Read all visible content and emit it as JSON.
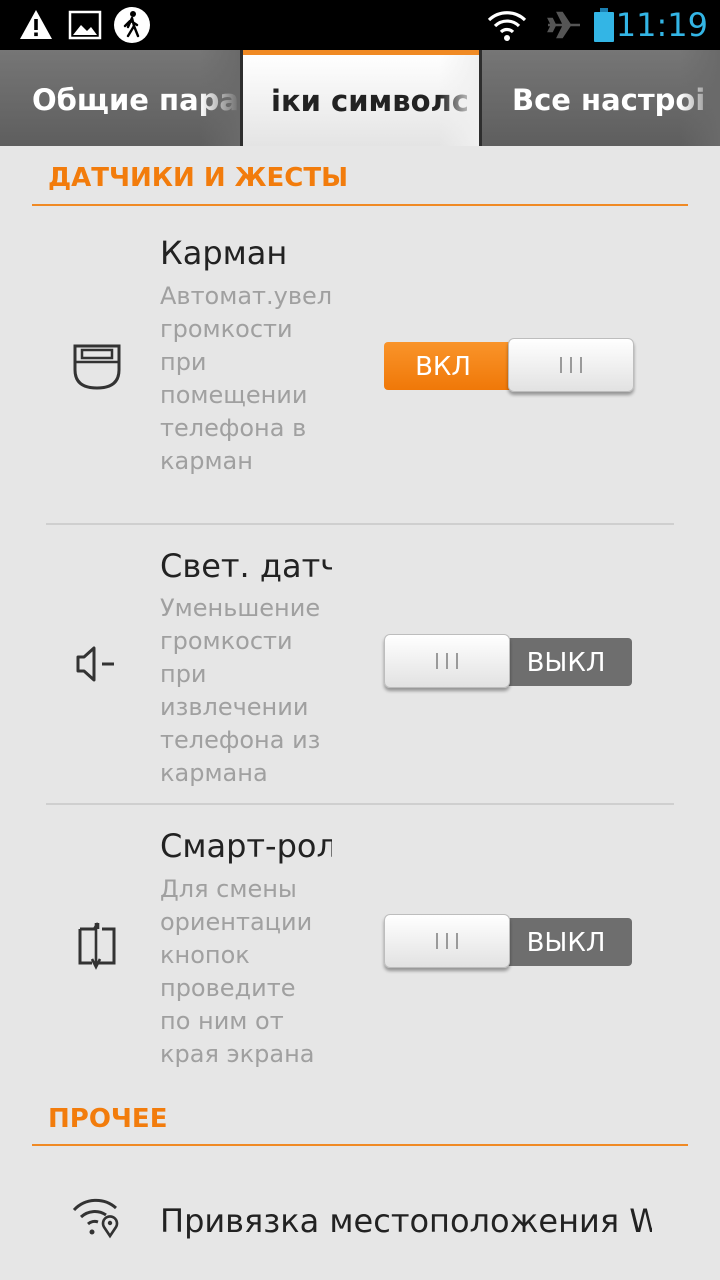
{
  "status_bar": {
    "icons": [
      "warning-icon",
      "image-icon",
      "walking-person-icon",
      "wifi-icon",
      "airplane-icon",
      "battery-icon"
    ],
    "time": "11:19",
    "time_color": "#33b5e5"
  },
  "tabs": [
    {
      "label": "Общие пара",
      "active": false
    },
    {
      "label": "іки символс",
      "active": true
    },
    {
      "label": "Все настроі",
      "active": false
    }
  ],
  "accent_color": "#f27c0c",
  "sections": [
    {
      "header": "ДАТЧИКИ И ЖЕСТЫ",
      "items": [
        {
          "icon": "pocket-icon",
          "title": "Карман",
          "description": "Автомат.увеличение громкости при помещении телефона в карман",
          "toggle": {
            "state": "on",
            "label": "ВКЛ"
          }
        },
        {
          "icon": "speaker-minus-icon",
          "title": "Свет. датч",
          "description": "Уменьшение громкости при извлечении телефона из кармана",
          "toggle": {
            "state": "off",
            "label": "ВЫКЛ"
          }
        },
        {
          "icon": "rotate-buttons-icon",
          "title": "Смарт-рол",
          "description": "Для смены ориентации кнопок проведите по ним от края экрана",
          "toggle": {
            "state": "off",
            "label": "ВЫКЛ"
          }
        }
      ]
    },
    {
      "header": "ПРОЧЕЕ",
      "items": [
        {
          "icon": "wifi-location-icon",
          "title": "Привязка местоположения W"
        }
      ]
    }
  ]
}
